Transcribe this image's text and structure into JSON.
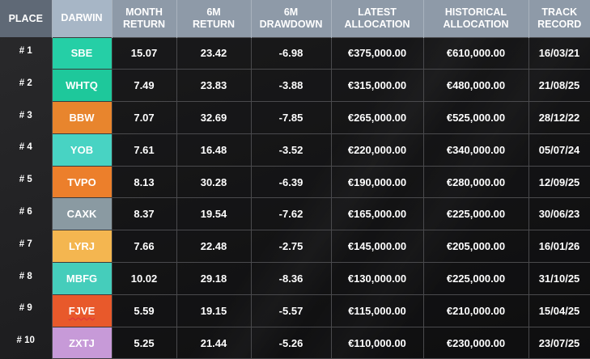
{
  "headers": {
    "place": "PLACE",
    "darwin": "DARWIN",
    "month_return": [
      "MONTH",
      "RETURN"
    ],
    "six_m_return": [
      "6M",
      "RETURN"
    ],
    "six_m_drawdown": [
      "6M",
      "DRAWDOWN"
    ],
    "latest_allocation": [
      "LATEST",
      "ALLOCATION"
    ],
    "historical_allocation": [
      "HISTORICAL",
      "ALLOCATION"
    ],
    "track_record": [
      "TRACK",
      "RECORD"
    ]
  },
  "rows": [
    {
      "place": "# 1",
      "darwin": "SBE",
      "color": "#25cfa6",
      "month_return": "15.07",
      "six_m_return": "23.42",
      "six_m_drawdown": "-6.98",
      "latest_allocation": "€375,000.00",
      "historical_allocation": "€610,000.00",
      "track_record": "16/03/21"
    },
    {
      "place": "# 2",
      "darwin": "WHTQ",
      "color": "#1ec89b",
      "month_return": "7.49",
      "six_m_return": "23.83",
      "six_m_drawdown": "-3.88",
      "latest_allocation": "€315,000.00",
      "historical_allocation": "€480,000.00",
      "track_record": "21/08/25"
    },
    {
      "place": "# 3",
      "darwin": "BBW",
      "color": "#e8852d",
      "month_return": "7.07",
      "six_m_return": "32.69",
      "six_m_drawdown": "-7.85",
      "latest_allocation": "€265,000.00",
      "historical_allocation": "€525,000.00",
      "track_record": "28/12/22"
    },
    {
      "place": "# 4",
      "darwin": "YOB",
      "color": "#48d3c3",
      "month_return": "7.61",
      "six_m_return": "16.48",
      "six_m_drawdown": "-3.52",
      "latest_allocation": "€220,000.00",
      "historical_allocation": "€340,000.00",
      "track_record": "05/07/24"
    },
    {
      "place": "# 5",
      "darwin": "TVPO",
      "color": "#ec7f2b",
      "month_return": "8.13",
      "six_m_return": "30.28",
      "six_m_drawdown": "-6.39",
      "latest_allocation": "€190,000.00",
      "historical_allocation": "€280,000.00",
      "track_record": "12/09/25"
    },
    {
      "place": "# 6",
      "darwin": "CAXK",
      "color": "#8a9aa2",
      "month_return": "8.37",
      "six_m_return": "19.54",
      "six_m_drawdown": "-7.62",
      "latest_allocation": "€165,000.00",
      "historical_allocation": "€225,000.00",
      "track_record": "30/06/23"
    },
    {
      "place": "# 7",
      "darwin": "LYRJ",
      "color": "#f4b650",
      "month_return": "7.66",
      "six_m_return": "22.48",
      "six_m_drawdown": "-2.75",
      "latest_allocation": "€145,000.00",
      "historical_allocation": "€205,000.00",
      "track_record": "16/01/26"
    },
    {
      "place": "# 8",
      "darwin": "MBFG",
      "color": "#45cdbb",
      "month_return": "10.02",
      "six_m_return": "29.18",
      "six_m_drawdown": "-8.36",
      "latest_allocation": "€130,000.00",
      "historical_allocation": "€225,000.00",
      "track_record": "31/10/25"
    },
    {
      "place": "# 9",
      "darwin": "FJVE",
      "color": "#e8592b",
      "month_return": "5.59",
      "six_m_return": "19.15",
      "six_m_drawdown": "-5.57",
      "latest_allocation": "€115,000.00",
      "historical_allocation": "€210,000.00",
      "track_record": "15/04/25",
      "spellcheck": true
    },
    {
      "place": "# 10",
      "darwin": "ZXTJ",
      "color": "#c79ad8",
      "month_return": "5.25",
      "six_m_return": "21.44",
      "six_m_drawdown": "-5.26",
      "latest_allocation": "€110,000.00",
      "historical_allocation": "€230,000.00",
      "track_record": "23/07/25"
    }
  ]
}
